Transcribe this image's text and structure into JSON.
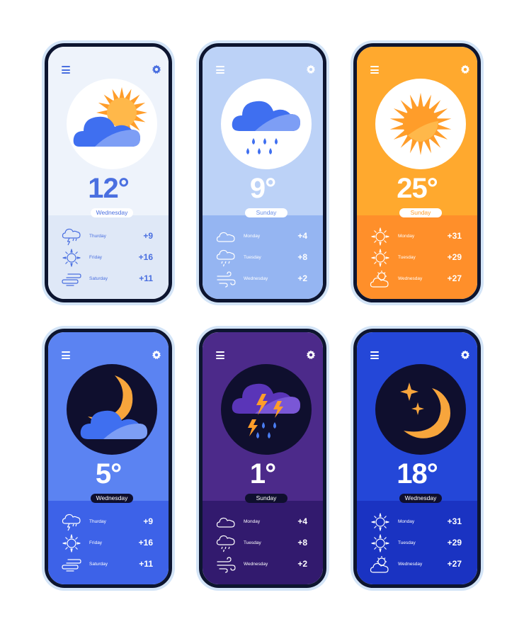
{
  "colors": {
    "frame": "#0d1530",
    "bezel": "#d3e4f7",
    "cloud_blue": "#3f6ff0",
    "sun_orange": "#ff9d2a",
    "moon_orange": "#f7a53c"
  },
  "phones": [
    {
      "temp": "12°",
      "day": "Wednesday",
      "main_icon": "sun-cloud-icon",
      "forecast": [
        {
          "day": "Thurday",
          "temp": "+9",
          "icon": "storm-cloud-icon"
        },
        {
          "day": "Friday",
          "temp": "+16",
          "icon": "sun-icon"
        },
        {
          "day": "Saturday",
          "temp": "+11",
          "icon": "fog-icon"
        }
      ]
    },
    {
      "temp": "9°",
      "day": "Sunday",
      "main_icon": "rain-cloud-icon",
      "forecast": [
        {
          "day": "Monday",
          "temp": "+4",
          "icon": "cloud-icon"
        },
        {
          "day": "Tuesday",
          "temp": "+8",
          "icon": "rain-cloud-icon"
        },
        {
          "day": "Wednesday",
          "temp": "+2",
          "icon": "wind-icon"
        }
      ]
    },
    {
      "temp": "25°",
      "day": "Sunday",
      "main_icon": "sun-icon",
      "forecast": [
        {
          "day": "Monday",
          "temp": "+31",
          "icon": "sun-icon"
        },
        {
          "day": "Tuesday",
          "temp": "+29",
          "icon": "sun-icon"
        },
        {
          "day": "Wednesday",
          "temp": "+27",
          "icon": "sun-cloud-icon"
        }
      ]
    },
    {
      "temp": "5°",
      "day": "Wednesday",
      "main_icon": "moon-cloud-icon",
      "forecast": [
        {
          "day": "Thurday",
          "temp": "+9",
          "icon": "storm-cloud-icon"
        },
        {
          "day": "Friday",
          "temp": "+16",
          "icon": "sun-icon"
        },
        {
          "day": "Saturday",
          "temp": "+11",
          "icon": "fog-icon"
        }
      ]
    },
    {
      "temp": "1°",
      "day": "Sunday",
      "main_icon": "thunderstorm-icon",
      "forecast": [
        {
          "day": "Monday",
          "temp": "+4",
          "icon": "cloud-icon"
        },
        {
          "day": "Tuesday",
          "temp": "+8",
          "icon": "rain-cloud-icon"
        },
        {
          "day": "Wednesday",
          "temp": "+2",
          "icon": "wind-icon"
        }
      ]
    },
    {
      "temp": "18°",
      "day": "Wednesday",
      "main_icon": "moon-stars-icon",
      "forecast": [
        {
          "day": "Monday",
          "temp": "+31",
          "icon": "sun-icon"
        },
        {
          "day": "Tuesday",
          "temp": "+29",
          "icon": "sun-icon"
        },
        {
          "day": "Wednesday",
          "temp": "+27",
          "icon": "sun-cloud-icon"
        }
      ]
    }
  ]
}
